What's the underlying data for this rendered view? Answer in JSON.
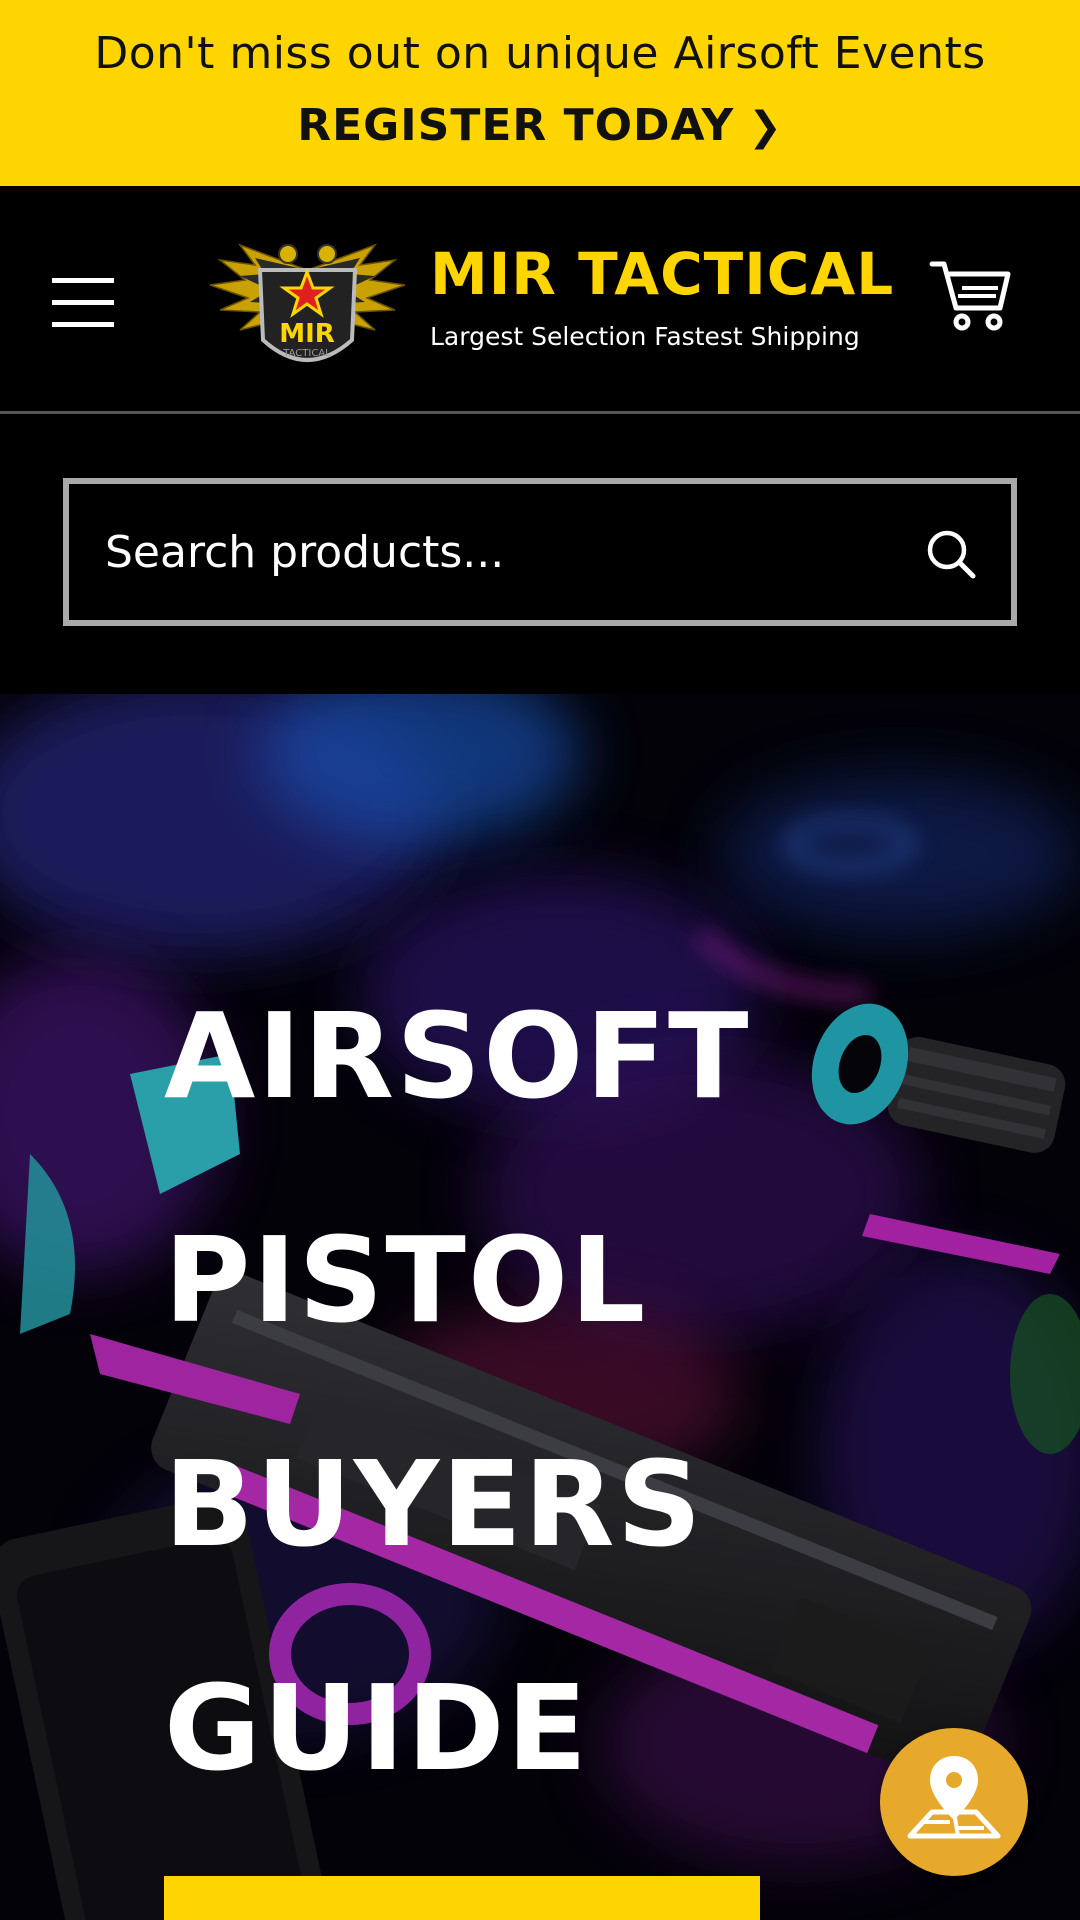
{
  "announcement": {
    "message": "Don't miss out on unique Airsoft Events",
    "cta_label": "REGISTER TODAY",
    "cta_icon": "chevron-right-icon"
  },
  "header": {
    "menu_icon": "hamburger-menu-icon",
    "logo_text": "MIR",
    "logo_subtext": "TACTICAL",
    "brand_name": "MIR TACTICAL",
    "tagline": "Largest Selection Fastest Shipping",
    "cart_icon": "shopping-cart-icon"
  },
  "search": {
    "placeholder": "Search products...",
    "icon": "search-icon"
  },
  "hero": {
    "title_lines": [
      "AIRSOFT",
      "PISTOL",
      "BUYERS",
      "GUIDE"
    ]
  },
  "floating": {
    "locator_icon": "map-location-pin-icon"
  },
  "colors": {
    "accent_yellow": "#ffd500",
    "background": "#000000",
    "border_gray": "#a9a9a9",
    "locator_gold": "#e6a92b"
  }
}
